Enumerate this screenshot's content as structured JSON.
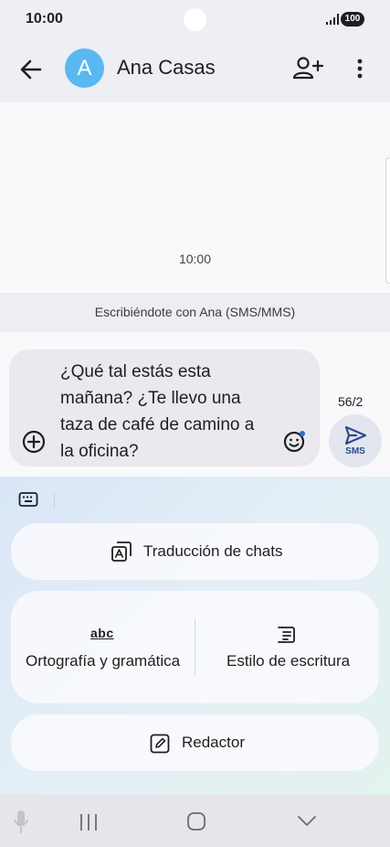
{
  "status_bar": {
    "time": "10:00",
    "battery": "100"
  },
  "app_bar": {
    "avatar_letter": "A",
    "contact_name": "Ana Casas"
  },
  "conversation": {
    "timestamp": "10:00",
    "info_text": "Escribiéndote con Ana (SMS/MMS)"
  },
  "composer": {
    "message_lines": [
      "¿Qué tal estás esta",
      "mañana? ¿Te llevo una",
      "taza de café de camino a",
      "la oficina?"
    ],
    "char_counter": "56/2",
    "send_label": "SMS"
  },
  "ai_panel": {
    "chat_translation": "Traducción de chats",
    "spelling_grammar": "Ortografía y gramática",
    "writing_style": "Estilo de escritura",
    "composer": "Redactor",
    "spelling_icon_text": "abc"
  },
  "colors": {
    "avatar": "#5ab8f0",
    "send_icon": "#2b4a8c"
  }
}
